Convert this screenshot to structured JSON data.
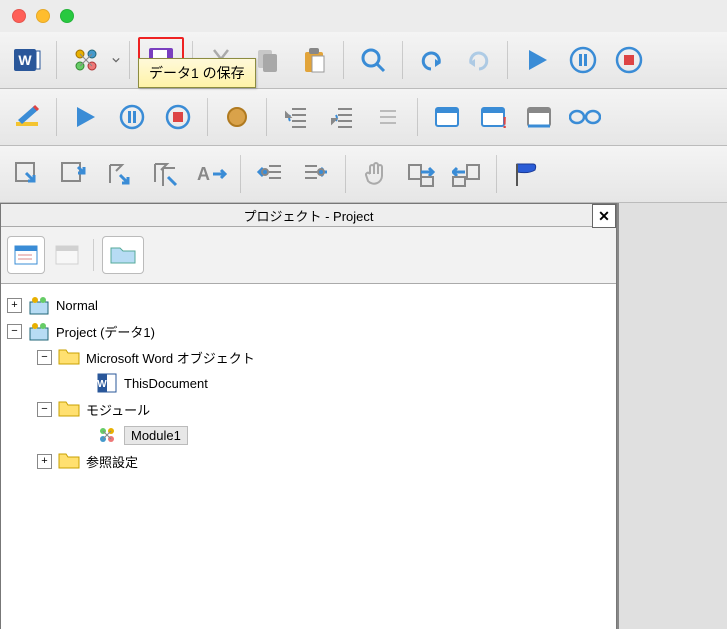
{
  "tooltip": {
    "text": "データ1 の保存"
  },
  "panel": {
    "title": "プロジェクト - Project",
    "close": "✕"
  },
  "tree": {
    "normal": "Normal",
    "project": "Project (データ1)",
    "word_objects": "Microsoft Word オブジェクト",
    "this_document": "ThisDocument",
    "modules": "モジュール",
    "module1": "Module1",
    "references": "参照設定"
  },
  "icons": {
    "plus": "+",
    "minus": "−"
  }
}
